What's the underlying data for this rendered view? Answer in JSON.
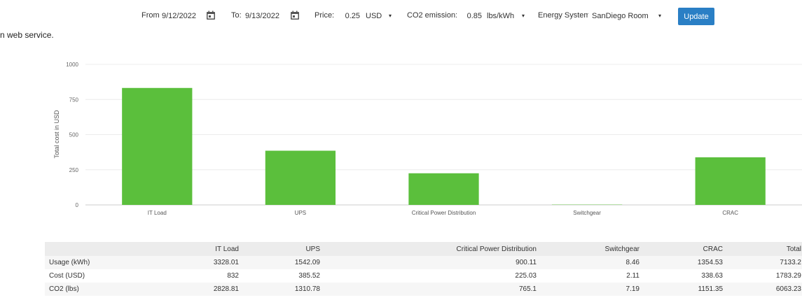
{
  "toolbar": {
    "from_label": "From:",
    "from_value": "9/12/2022",
    "to_label": "To:",
    "to_value": "9/13/2022",
    "price_label": "Price:",
    "price_value": "0.25",
    "currency": "USD",
    "co2_label": "CO2 emission:",
    "co2_value": "0.85",
    "co2_unit": "lbs/kWh",
    "energy_label": "Energy System:",
    "energy_value": "SanDiego Room",
    "update_label": "Update",
    "calendar_icon": "calendar-icon",
    "dropdown_icon": "chevron-down-icon",
    "accent_color": "#2a7fc5"
  },
  "intro_text": "n web service.",
  "chart_data": {
    "type": "bar",
    "categories": [
      "IT Load",
      "UPS",
      "Critical Power Distribution",
      "Switchgear",
      "CRAC"
    ],
    "values": [
      832,
      385.52,
      225.03,
      2.11,
      338.63
    ],
    "ylabel": "Total cost in USD",
    "xlabel": "",
    "ylim": [
      0,
      1000
    ],
    "yticks": [
      0,
      250,
      500,
      750,
      1000
    ],
    "grid": true,
    "bar_color": "#5bbf3c"
  },
  "table": {
    "headers": [
      "",
      "IT Load",
      "UPS",
      "Critical Power Distribution",
      "Switchgear",
      "CRAC",
      "Total"
    ],
    "rows": [
      [
        "Usage (kWh)",
        "3328.01",
        "1542.09",
        "900.11",
        "8.46",
        "1354.53",
        "7133.2"
      ],
      [
        "Cost (USD)",
        "832",
        "385.52",
        "225.03",
        "2.11",
        "338.63",
        "1783.29"
      ],
      [
        "CO2 (lbs)",
        "2828.81",
        "1310.78",
        "765.1",
        "7.19",
        "1151.35",
        "6063.23"
      ]
    ]
  }
}
